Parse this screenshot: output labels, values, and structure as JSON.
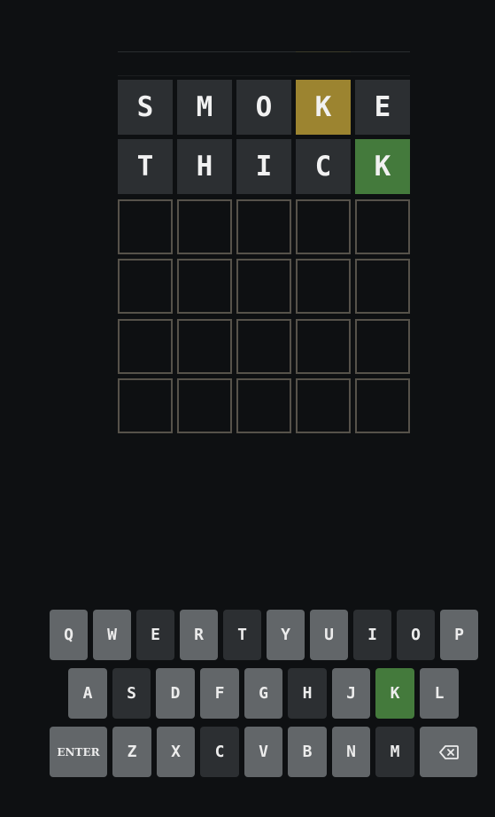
{
  "board": {
    "rows": [
      [
        {
          "letter": "S",
          "state": "absent"
        },
        {
          "letter": "M",
          "state": "absent"
        },
        {
          "letter": "O",
          "state": "absent"
        },
        {
          "letter": "K",
          "state": "present"
        },
        {
          "letter": "E",
          "state": "absent"
        }
      ],
      [
        {
          "letter": "T",
          "state": "absent"
        },
        {
          "letter": "H",
          "state": "absent"
        },
        {
          "letter": "I",
          "state": "absent"
        },
        {
          "letter": "C",
          "state": "absent"
        },
        {
          "letter": "K",
          "state": "correct"
        }
      ],
      [
        {
          "letter": "",
          "state": "empty"
        },
        {
          "letter": "",
          "state": "empty"
        },
        {
          "letter": "",
          "state": "empty"
        },
        {
          "letter": "",
          "state": "empty"
        },
        {
          "letter": "",
          "state": "empty"
        }
      ],
      [
        {
          "letter": "",
          "state": "empty"
        },
        {
          "letter": "",
          "state": "empty"
        },
        {
          "letter": "",
          "state": "empty"
        },
        {
          "letter": "",
          "state": "empty"
        },
        {
          "letter": "",
          "state": "empty"
        }
      ],
      [
        {
          "letter": "",
          "state": "empty"
        },
        {
          "letter": "",
          "state": "empty"
        },
        {
          "letter": "",
          "state": "empty"
        },
        {
          "letter": "",
          "state": "empty"
        },
        {
          "letter": "",
          "state": "empty"
        }
      ],
      [
        {
          "letter": "",
          "state": "empty"
        },
        {
          "letter": "",
          "state": "empty"
        },
        {
          "letter": "",
          "state": "empty"
        },
        {
          "letter": "",
          "state": "empty"
        },
        {
          "letter": "",
          "state": "empty"
        }
      ]
    ]
  },
  "keyboard": {
    "row1": [
      {
        "label": "Q",
        "state": "unused"
      },
      {
        "label": "W",
        "state": "unused"
      },
      {
        "label": "E",
        "state": "absent"
      },
      {
        "label": "R",
        "state": "unused"
      },
      {
        "label": "T",
        "state": "absent"
      },
      {
        "label": "Y",
        "state": "unused"
      },
      {
        "label": "U",
        "state": "unused"
      },
      {
        "label": "I",
        "state": "absent"
      },
      {
        "label": "O",
        "state": "absent"
      },
      {
        "label": "P",
        "state": "unused"
      }
    ],
    "row2": [
      {
        "label": "A",
        "state": "unused"
      },
      {
        "label": "S",
        "state": "absent"
      },
      {
        "label": "D",
        "state": "unused"
      },
      {
        "label": "F",
        "state": "unused"
      },
      {
        "label": "G",
        "state": "unused"
      },
      {
        "label": "H",
        "state": "absent"
      },
      {
        "label": "J",
        "state": "unused"
      },
      {
        "label": "K",
        "state": "correct"
      },
      {
        "label": "L",
        "state": "unused"
      }
    ],
    "row3": [
      {
        "label": "ENTER",
        "state": "unused"
      },
      {
        "label": "Z",
        "state": "unused"
      },
      {
        "label": "X",
        "state": "unused"
      },
      {
        "label": "C",
        "state": "absent"
      },
      {
        "label": "V",
        "state": "unused"
      },
      {
        "label": "B",
        "state": "unused"
      },
      {
        "label": "N",
        "state": "unused"
      },
      {
        "label": "M",
        "state": "absent"
      },
      {
        "label": "backspace-icon",
        "state": "unused"
      }
    ]
  },
  "colors": {
    "background": "#0e1012",
    "absent": "#2c2f32",
    "present": "#9c8430",
    "correct": "#447a3c",
    "key_unused": "#626669",
    "empty_border": "#56524a"
  }
}
